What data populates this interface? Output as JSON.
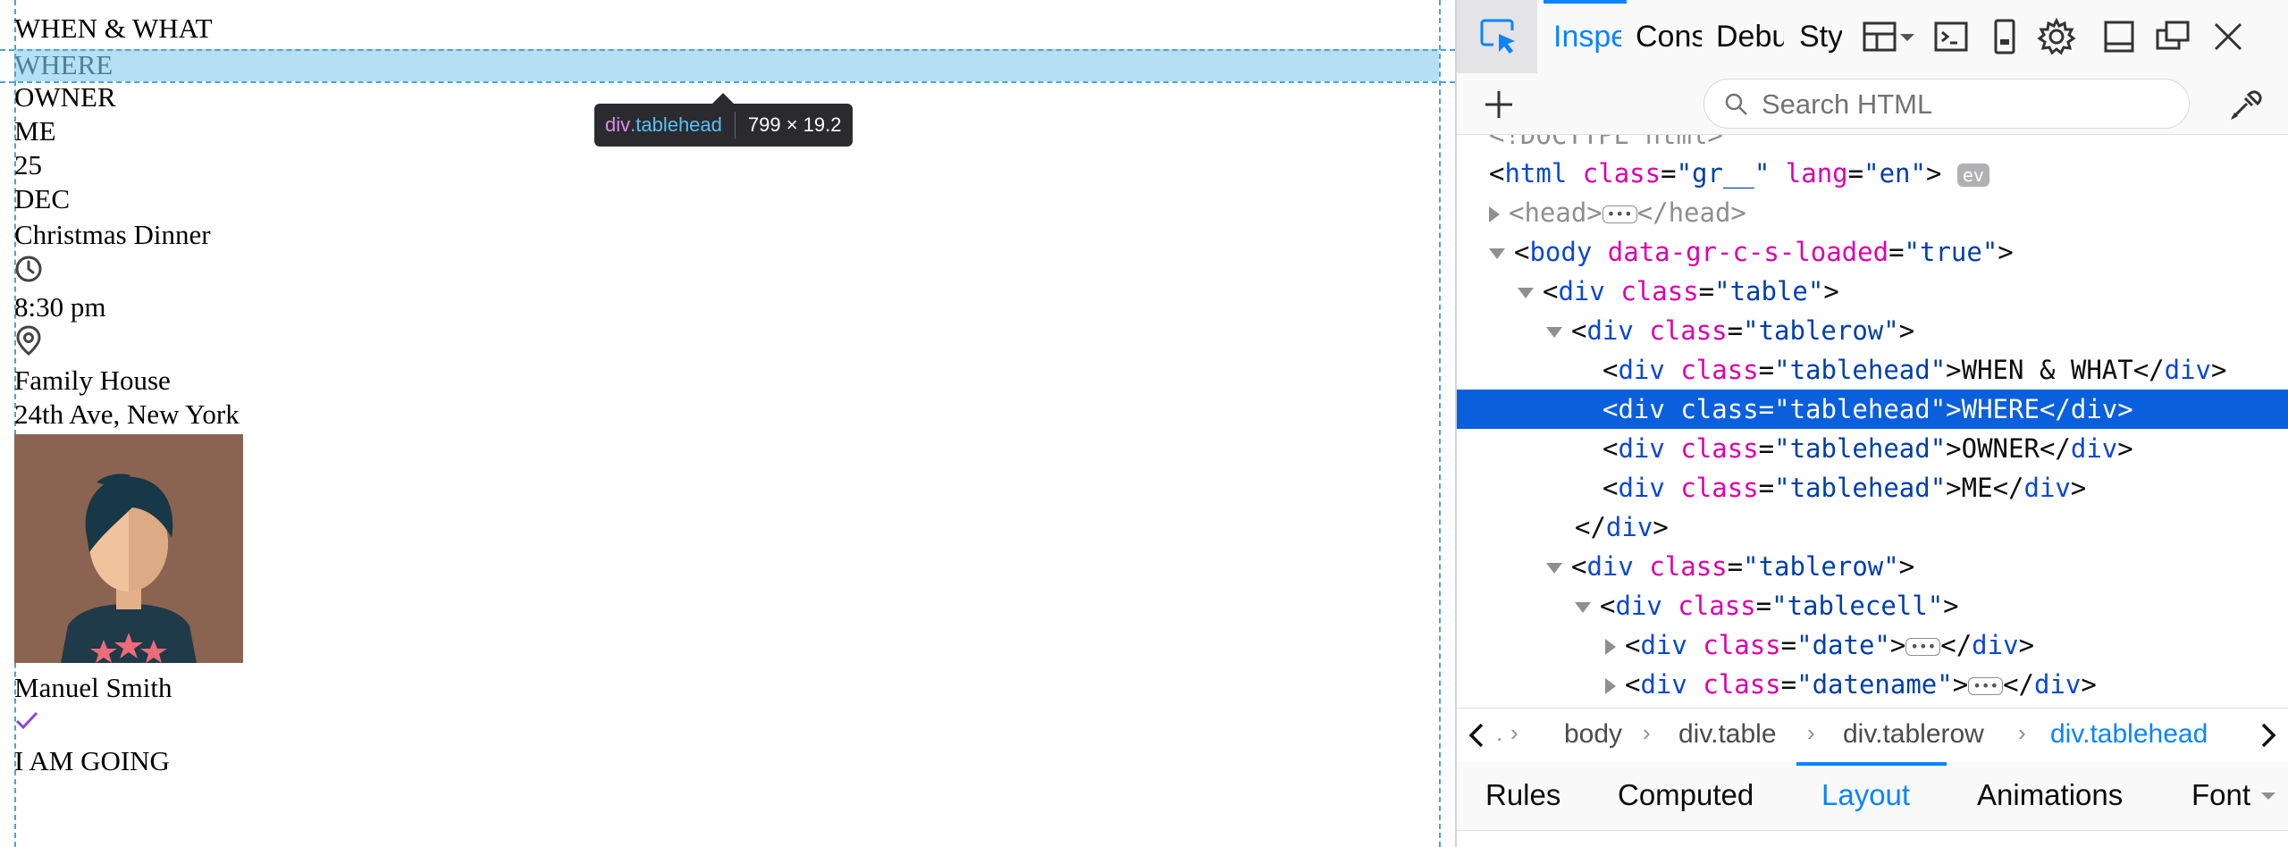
{
  "page": {
    "header_1": "WHEN & WHAT",
    "header_2": "WHERE",
    "header_3": "OWNER",
    "header_4": "ME",
    "date_day": "25",
    "date_month": "DEC",
    "event_name": "Christmas Dinner",
    "time": "8:30 pm",
    "location_name": "Family House",
    "location_address": "24th Ave, New York",
    "owner_name": "Manuel Smith",
    "rsvp_status": "I AM GOING",
    "highlight_color": "#78c4e8",
    "check_color": "#8e44d4"
  },
  "tooltip": {
    "tag": "div",
    "class": ".tablehead",
    "dimensions": "799 × 19.2"
  },
  "devtools": {
    "tabs": [
      "Inspe",
      "Cons",
      "Debu",
      "Sty"
    ],
    "search_placeholder": "Search HTML",
    "markup": {
      "doctype": "<!DOCTYPE html>",
      "html_open_tag": "html",
      "html_class_attr": "class",
      "html_class_val": "\"gr__\"",
      "html_lang_attr": "lang",
      "html_lang_val": "\"en\"",
      "ev_badge": "ev",
      "head_open": "<head>",
      "head_close": "</head>",
      "body_tag": "body",
      "body_attr": "data-gr-c-s-loaded",
      "body_val": "\"true\"",
      "div_tag": "div",
      "class_attr": "class",
      "table_val": "\"table\"",
      "tablerow_val": "\"tablerow\"",
      "tablehead_val": "\"tablehead\"",
      "tablecell_val": "\"tablecell\"",
      "date_val": "\"date\"",
      "datename_val": "\"datename\"",
      "head_text_1": "WHEN & WHAT",
      "head_text_2": "WHERE",
      "head_text_3": "OWNER",
      "head_text_4": "ME"
    },
    "breadcrumbs": [
      "body",
      "div.table",
      "div.tablerow",
      "div.tablehead"
    ],
    "sidebar_tabs": [
      "Rules",
      "Computed",
      "Layout",
      "Animations",
      "Font"
    ],
    "accent_color": "#0a84ff"
  }
}
